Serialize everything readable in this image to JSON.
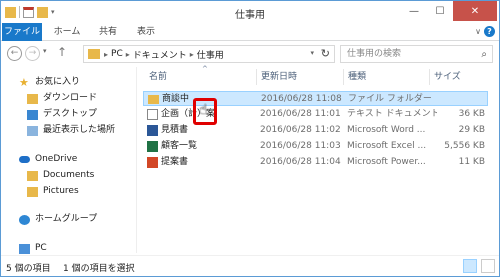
{
  "window": {
    "title": "仕事用",
    "close_label": "✕",
    "min_label": "—",
    "max_label": "☐"
  },
  "ribbon": {
    "tabs": [
      "ファイル",
      "ホーム",
      "共有",
      "表示"
    ],
    "help_label": "?"
  },
  "address": {
    "crumbs": [
      "PC",
      "ドキュメント",
      "仕事用"
    ],
    "separator": "▸"
  },
  "search": {
    "placeholder": "仕事用の検索"
  },
  "nav_pane": {
    "favorites": "お気に入り",
    "downloads": "ダウンロード",
    "desktop": "デスクトップ",
    "recent": "最近表示した場所",
    "onedrive": "OneDrive",
    "documents": "Documents",
    "pictures": "Pictures",
    "homegroup": "ホームグループ",
    "pc": "PC"
  },
  "columns": {
    "name": "名前",
    "date": "更新日時",
    "type": "種類",
    "size": "サイズ"
  },
  "files": [
    {
      "name": "商談中",
      "date": "2016/06/28 11:08",
      "type": "ファイル フォルダー",
      "size": "",
      "icon": "folder-icon"
    },
    {
      "name": "企画（計）案",
      "date": "2016/06/28 11:01",
      "type": "テキスト ドキュメント",
      "size": "36 KB",
      "icon": "text-file-icon"
    },
    {
      "name": "見積書",
      "date": "2016/06/28 11:02",
      "type": "Microsoft Word ...",
      "size": "29 KB",
      "icon": "word-file-icon"
    },
    {
      "name": "顧客一覧",
      "date": "2016/06/28 11:03",
      "type": "Microsoft Excel ...",
      "size": "5,556 KB",
      "icon": "excel-file-icon"
    },
    {
      "name": "提案書",
      "date": "2016/06/28 11:04",
      "type": "Microsoft Power...",
      "size": "11 KB",
      "icon": "powerpoint-file-icon"
    }
  ],
  "status": {
    "item_count": "5 個の項目",
    "selected": "1 個の項目を選択"
  },
  "colors": {
    "accent": "#1979ca",
    "selection": "#cce8ff",
    "highlight": "#e00000"
  }
}
